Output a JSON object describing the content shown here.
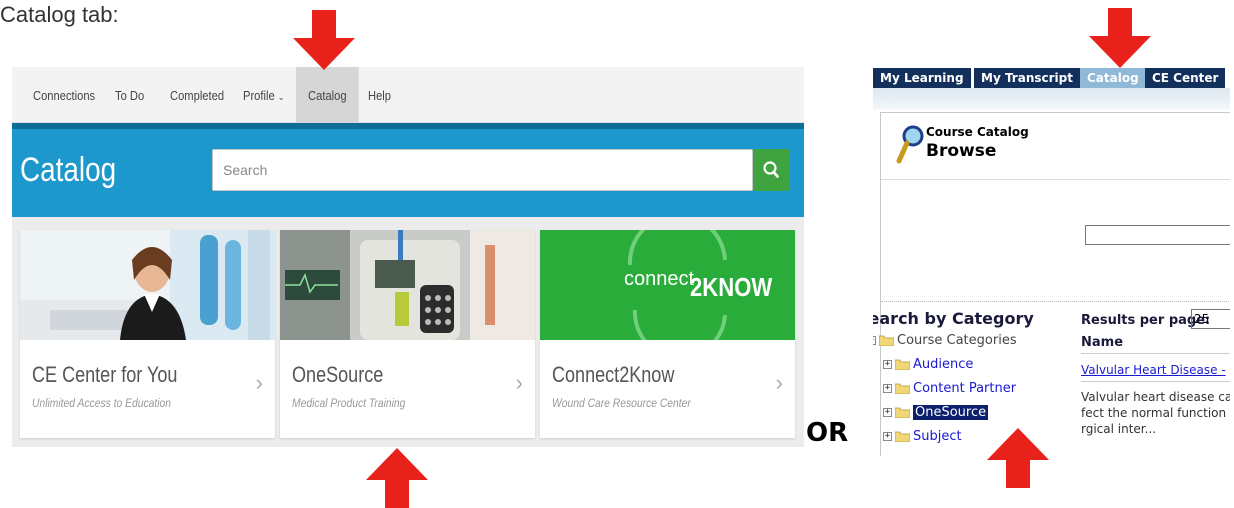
{
  "caption": "Catalog tab:",
  "left": {
    "nav": [
      {
        "label": "Connections"
      },
      {
        "label": "To Do"
      },
      {
        "label": "Completed"
      },
      {
        "label": "Profile",
        "has_chevron": true
      },
      {
        "label": "Catalog",
        "active": true
      },
      {
        "label": "Help"
      }
    ],
    "profile_chevron": "⌄",
    "banner_title": "Catalog",
    "search_placeholder": "Search",
    "cards": [
      {
        "title": "CE Center for You",
        "subtitle": "Unlimited Access to Education"
      },
      {
        "title": "OneSource",
        "subtitle": "Medical Product Training"
      },
      {
        "title": "Connect2Know",
        "subtitle": "Wound Care Resource Center"
      }
    ],
    "card_arrow": "›",
    "connect_logo_a": "connect",
    "connect_logo_b": "2KNOW"
  },
  "or_label": "OR",
  "right": {
    "tabs": [
      "My Learning",
      "My Transcript",
      "Catalog",
      "CE Center"
    ],
    "active_tab": "Catalog",
    "header_small": "Course Catalog",
    "header_big": "Browse",
    "search_by_category": "Search by Category",
    "tree": {
      "root": "Course Categories",
      "items": [
        "Audience",
        "Content Partner",
        "OneSource",
        "Subject"
      ],
      "selected": "OneSource"
    },
    "results_per_page_label": "Results per page:",
    "results_per_page_value": "25",
    "col_name": "Name",
    "result_link": "Valvular Heart Disease -",
    "result_desc": [
      "Valvular heart disease ca",
      "fect the normal function",
      "rgical inter..."
    ]
  },
  "colors": {
    "banner": "#1d98cc",
    "search_button": "#3fa33f",
    "arrow": "#e8221b",
    "tab_dark": "#13305c",
    "tab_active": "#8fb9d6",
    "tree_selected": "#0c1f6e"
  },
  "icons": [
    "search-icon",
    "magnifier-icon",
    "folder-icon",
    "expand-icon",
    "chevron-right-icon",
    "chevron-down-icon",
    "arrow-down-icon",
    "arrow-up-icon"
  ]
}
